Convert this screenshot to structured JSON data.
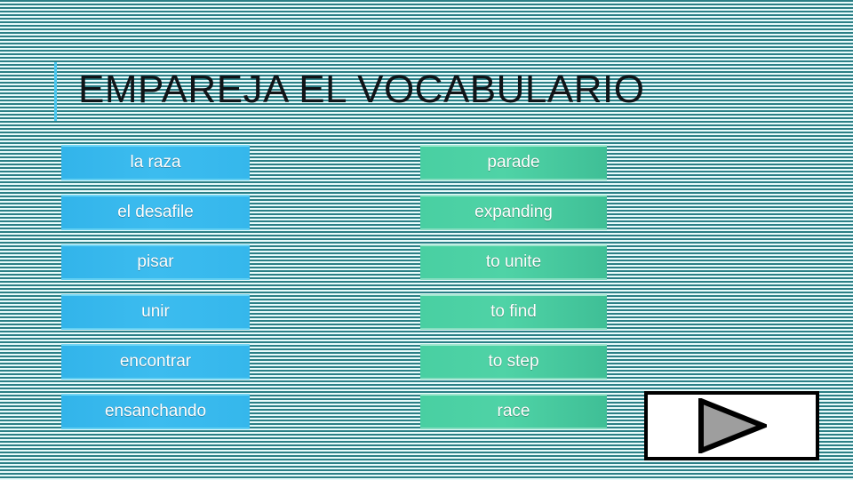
{
  "slide": {
    "title": "EMPAREJA EL VOCABULARIO",
    "accent_color": "#4bc8f0",
    "background_stripe_colors": [
      "#2b7f86",
      "#e8fbfb"
    ]
  },
  "left_column": {
    "name": "spanish-terms",
    "chip_color": "#3cbcef",
    "items": [
      {
        "label": "la raza"
      },
      {
        "label": "el desafile"
      },
      {
        "label": "pisar"
      },
      {
        "label": "unir"
      },
      {
        "label": "encontrar"
      },
      {
        "label": "ensanchando"
      }
    ]
  },
  "right_column": {
    "name": "english-terms",
    "chip_color": "#4fd3a6",
    "items": [
      {
        "label": "parade"
      },
      {
        "label": "expanding"
      },
      {
        "label": "to unite"
      },
      {
        "label": "to find"
      },
      {
        "label": "to step"
      },
      {
        "label": "race"
      }
    ]
  },
  "next_button": {
    "icon": "play-triangle-icon",
    "fill_color": "#9e9e9e",
    "border_color": "#000000",
    "background_color": "#ffffff"
  }
}
